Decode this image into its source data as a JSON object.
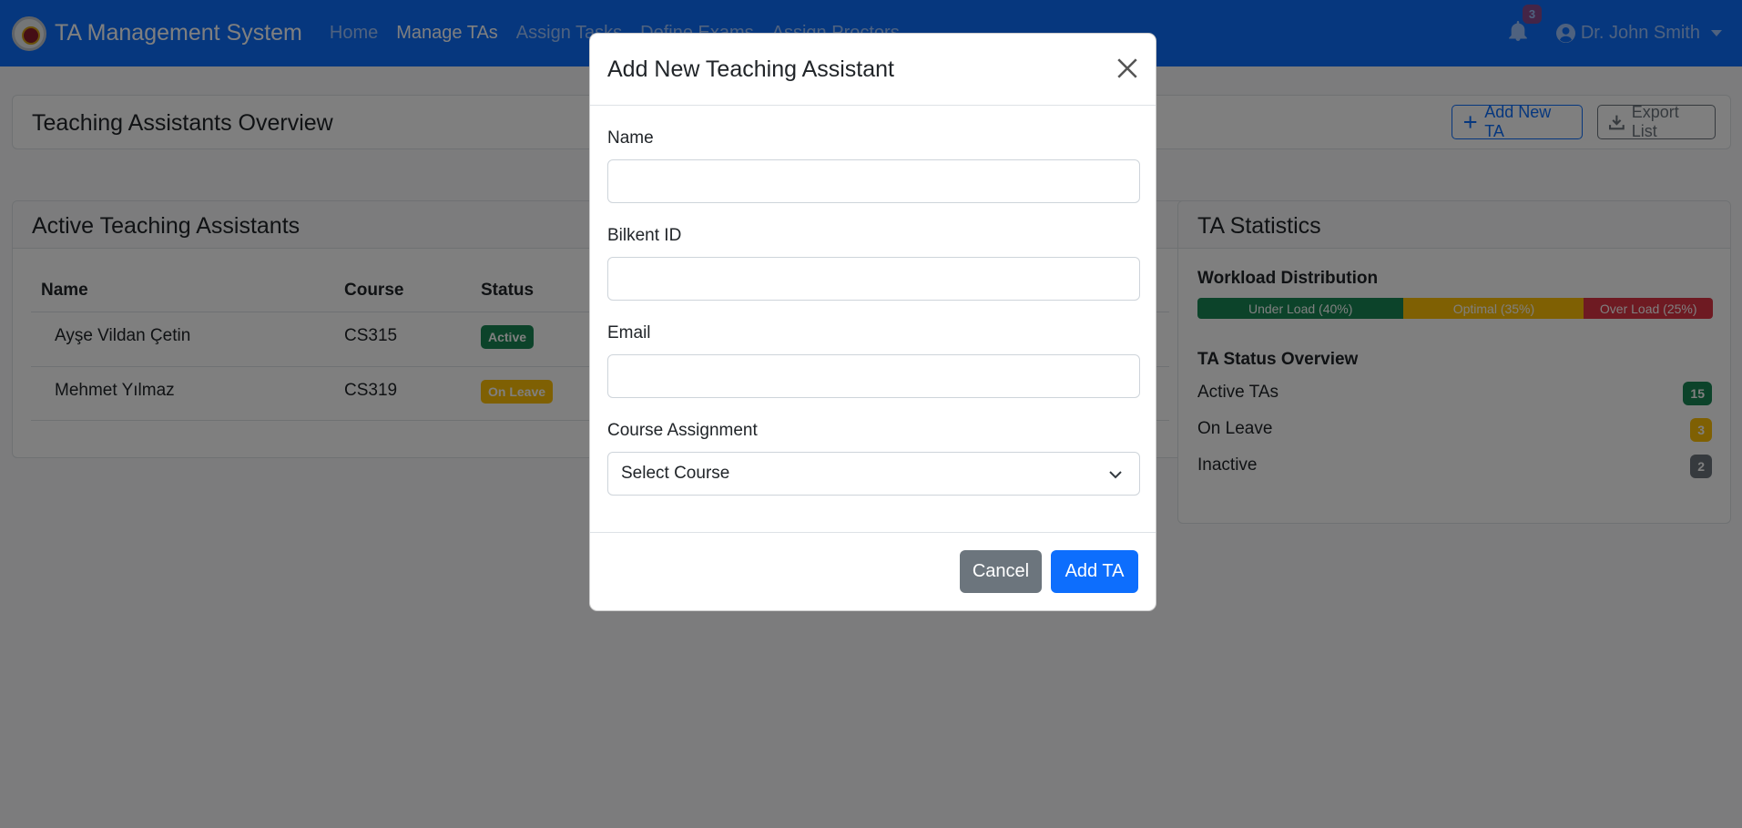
{
  "navbar": {
    "brand": "TA Management System",
    "links": [
      "Home",
      "Manage TAs",
      "Assign Tasks",
      "Define Exams",
      "Assign Proctors"
    ],
    "active_link": "Manage TAs",
    "notification_count": "3",
    "user_name": "Dr. John Smith"
  },
  "overview": {
    "title": "Teaching Assistants Overview",
    "add_button": "Add New TA",
    "export_button": "Export List"
  },
  "tas_table": {
    "title": "Active Teaching Assistants",
    "headers": [
      "Name",
      "Course",
      "Status"
    ],
    "rows": [
      {
        "name": "Ayşe Vildan Çetin",
        "course": "CS315",
        "status": "Active"
      },
      {
        "name": "Mehmet Yılmaz",
        "course": "CS319",
        "status": "On Leave"
      }
    ]
  },
  "stats": {
    "title": "TA Statistics",
    "workload_title": "Workload Distribution",
    "workload": [
      {
        "label": "Under Load (40%)",
        "percent": 40,
        "color": "#198754"
      },
      {
        "label": "Optimal (35%)",
        "percent": 35,
        "color": "#ffc107"
      },
      {
        "label": "Over Load (25%)",
        "percent": 25,
        "color": "#dc3545"
      }
    ],
    "status_title": "TA Status Overview",
    "status_items": [
      {
        "label": "Active TAs",
        "count": "15",
        "color": "#198754"
      },
      {
        "label": "On Leave",
        "count": "3",
        "color": "#ffc107"
      },
      {
        "label": "Inactive",
        "count": "2",
        "color": "#6c757d"
      }
    ]
  },
  "modal": {
    "title": "Add New Teaching Assistant",
    "name_label": "Name",
    "name_value": "",
    "id_label": "Bilkent ID",
    "id_value": "",
    "email_label": "Email",
    "email_value": "",
    "course_label": "Course Assignment",
    "course_selected": "Select Course",
    "cancel_button": "Cancel",
    "submit_button": "Add TA"
  }
}
